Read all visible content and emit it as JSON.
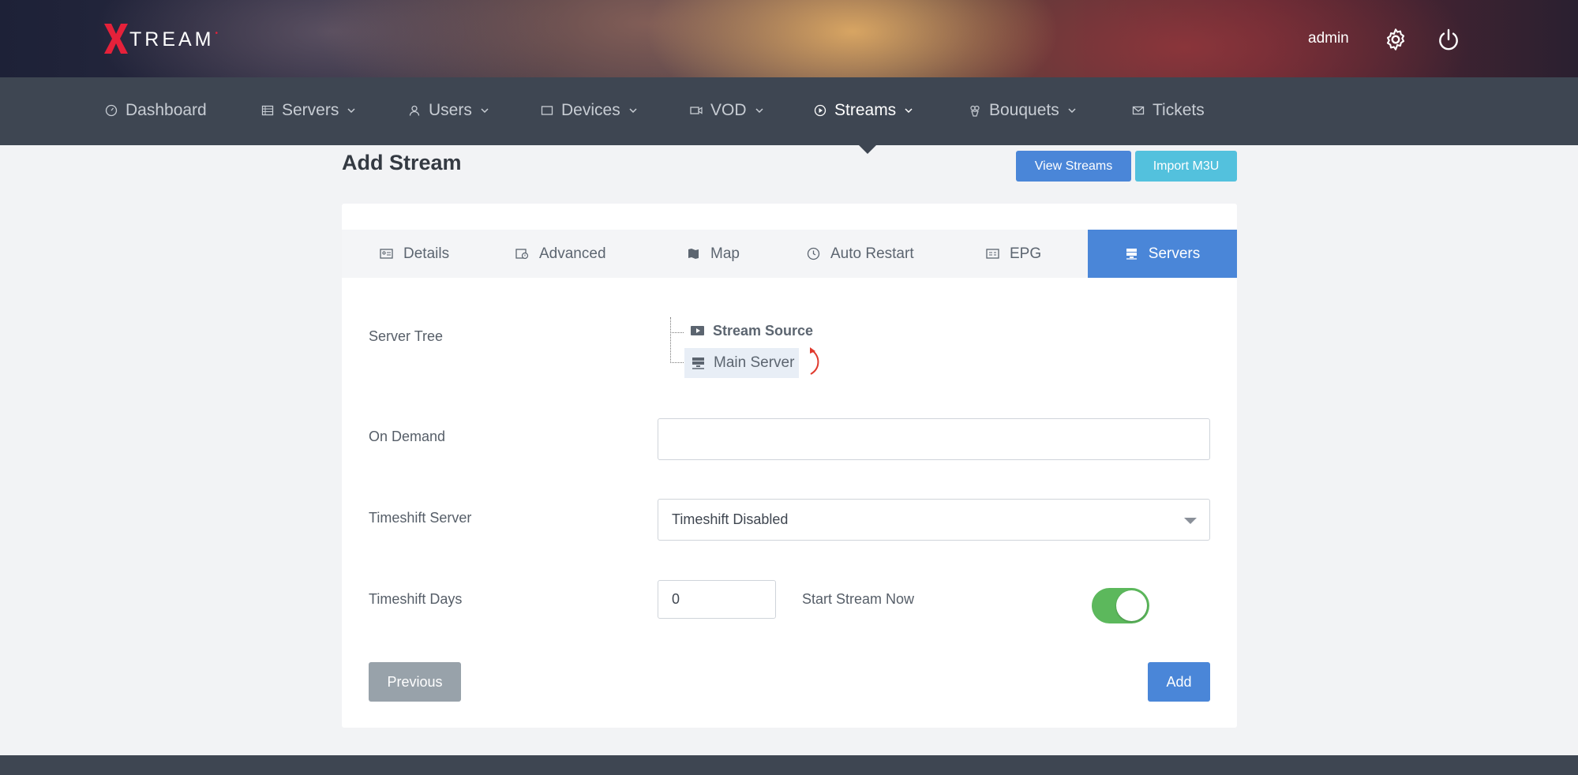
{
  "brand": {
    "logo_letter": "X",
    "logo_text": "TREAM",
    "logo_dot": "•",
    "accent_color": "#e5213a"
  },
  "header": {
    "user_label": "admin",
    "settings_icon": "gear-icon",
    "logout_icon": "power-icon"
  },
  "nav": {
    "items": [
      {
        "label": "Dashboard",
        "icon": "gauge-icon"
      },
      {
        "label": "Servers",
        "icon": "server-list-icon"
      },
      {
        "label": "Users",
        "icon": "user-icon"
      },
      {
        "label": "Devices",
        "icon": "tablet-icon"
      },
      {
        "label": "VOD",
        "icon": "video-camera-icon"
      },
      {
        "label": "Streams",
        "icon": "play-circle-icon"
      },
      {
        "label": "Bouquets",
        "icon": "bouquet-icon"
      },
      {
        "label": "Tickets",
        "icon": "envelope-icon"
      }
    ],
    "active": "Streams"
  },
  "page": {
    "title": "Add Stream",
    "view_streams_label": "View Streams",
    "import_label": "Import M3U"
  },
  "tabs": [
    {
      "label": "Details",
      "icon": "id-card-icon"
    },
    {
      "label": "Advanced",
      "icon": "calendar-clock-icon"
    },
    {
      "label": "Map",
      "icon": "map-icon"
    },
    {
      "label": "Auto Restart",
      "icon": "clock-icon"
    },
    {
      "label": "EPG",
      "icon": "tv-guide-icon"
    },
    {
      "label": "Servers",
      "icon": "server-stack-icon"
    }
  ],
  "active_tab": "Servers",
  "form": {
    "server_tree_label": "Server Tree",
    "tree": {
      "source_label": "Stream Source",
      "main_server_label": "Main Server"
    },
    "on_demand_label": "On Demand",
    "on_demand_value": "",
    "timeshift_server_label": "Timeshift Server",
    "timeshift_server_value": "Timeshift Disabled",
    "timeshift_days_label": "Timeshift Days",
    "timeshift_days_value": "0",
    "start_stream_label": "Start Stream Now",
    "start_stream_on": true,
    "previous_label": "Previous",
    "add_label": "Add"
  },
  "colors": {
    "primary": "#4a86d8",
    "info": "#53c1dd",
    "success": "#5cb85c",
    "nav_bg": "#3e4652",
    "secondary": "#98a2aa"
  }
}
